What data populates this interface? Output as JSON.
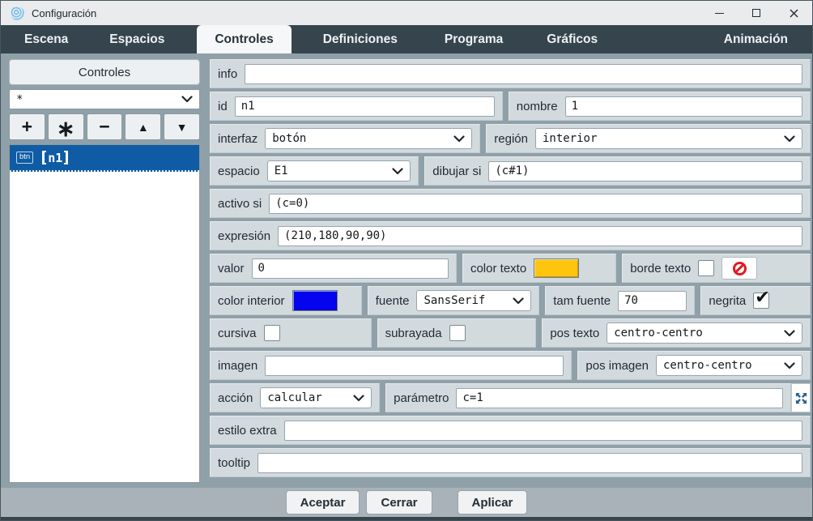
{
  "window": {
    "title": "Configuración",
    "controls": {
      "minimize": "minimize",
      "maximize": "maximize",
      "close": "close"
    }
  },
  "tabs": [
    {
      "label": "Escena",
      "active": false
    },
    {
      "label": "Espacios",
      "active": false
    },
    {
      "label": "Controles",
      "active": true
    },
    {
      "label": "Definiciones",
      "active": false
    },
    {
      "label": "Programa",
      "active": false
    },
    {
      "label": "Gráficos",
      "active": false
    },
    {
      "label": "Animación",
      "active": false
    }
  ],
  "left_panel": {
    "header": "Controles",
    "filter_value": "*",
    "toolbar": [
      {
        "name": "add",
        "glyph": "+"
      },
      {
        "name": "clone",
        "glyph": "∗"
      },
      {
        "name": "remove",
        "glyph": "−"
      },
      {
        "name": "move-up",
        "glyph": "▲"
      },
      {
        "name": "move-down",
        "glyph": "▼"
      }
    ],
    "list": [
      {
        "badge": "btn",
        "label": "n1",
        "label_raw": "【n1】",
        "selected": true
      }
    ]
  },
  "form": {
    "info": {
      "label": "info",
      "value": ""
    },
    "id": {
      "label": "id",
      "value": "n1"
    },
    "nombre": {
      "label": "nombre",
      "value": "1"
    },
    "interfaz": {
      "label": "interfaz",
      "value": "botón"
    },
    "region": {
      "label": "región",
      "value": "interior"
    },
    "espacio": {
      "label": "espacio",
      "value": "E1"
    },
    "dibujar_si": {
      "label": "dibujar si",
      "value": "(c#1)"
    },
    "activo_si": {
      "label": "activo si",
      "value": "(c=0)"
    },
    "expresion": {
      "label": "expresión",
      "value": "(210,180,90,90)"
    },
    "valor": {
      "label": "valor",
      "value": "0"
    },
    "color_texto": {
      "label": "color texto",
      "color": "#FFC40D"
    },
    "borde_texto": {
      "label": "borde texto",
      "checked": false
    },
    "color_interior": {
      "label": "color interior",
      "color": "#0404EE"
    },
    "fuente": {
      "label": "fuente",
      "value": "SansSerif"
    },
    "tam_fuente": {
      "label": "tam fuente",
      "value": "70"
    },
    "negrita": {
      "label": "negrita",
      "checked": true,
      "check_glyph": "✔"
    },
    "cursiva": {
      "label": "cursiva",
      "checked": false
    },
    "subrayada": {
      "label": "subrayada",
      "checked": false
    },
    "pos_texto": {
      "label": "pos texto",
      "value": "centro-centro"
    },
    "imagen": {
      "label": "imagen",
      "value": ""
    },
    "pos_imagen": {
      "label": "pos imagen",
      "value": "centro-centro"
    },
    "accion": {
      "label": "acción",
      "value": "calcular"
    },
    "parametro": {
      "label": "parámetro",
      "value": "c=1"
    },
    "estilo_extra": {
      "label": "estilo extra",
      "value": ""
    },
    "tooltip": {
      "label": "tooltip",
      "value": ""
    }
  },
  "footer": {
    "buttons": [
      "Aceptar",
      "Cerrar",
      "Aplicar"
    ]
  },
  "icons": {
    "app-icon": "concentric-blue-circle-logo",
    "chevron-down-icon": "⌄",
    "no-sign-icon": "red prohibition circle with slash",
    "expand-icon": "four diagonal arrows outward",
    "minimize-icon": "—",
    "maximize-icon": "□",
    "close-icon": "✕"
  },
  "colors": {
    "tab_bar": "#36454D",
    "selected_item": "#0F5CA5",
    "cell_background": "#D3DADE",
    "panel_background": "#90A0A8",
    "prohibition_red": "#E01B24"
  }
}
